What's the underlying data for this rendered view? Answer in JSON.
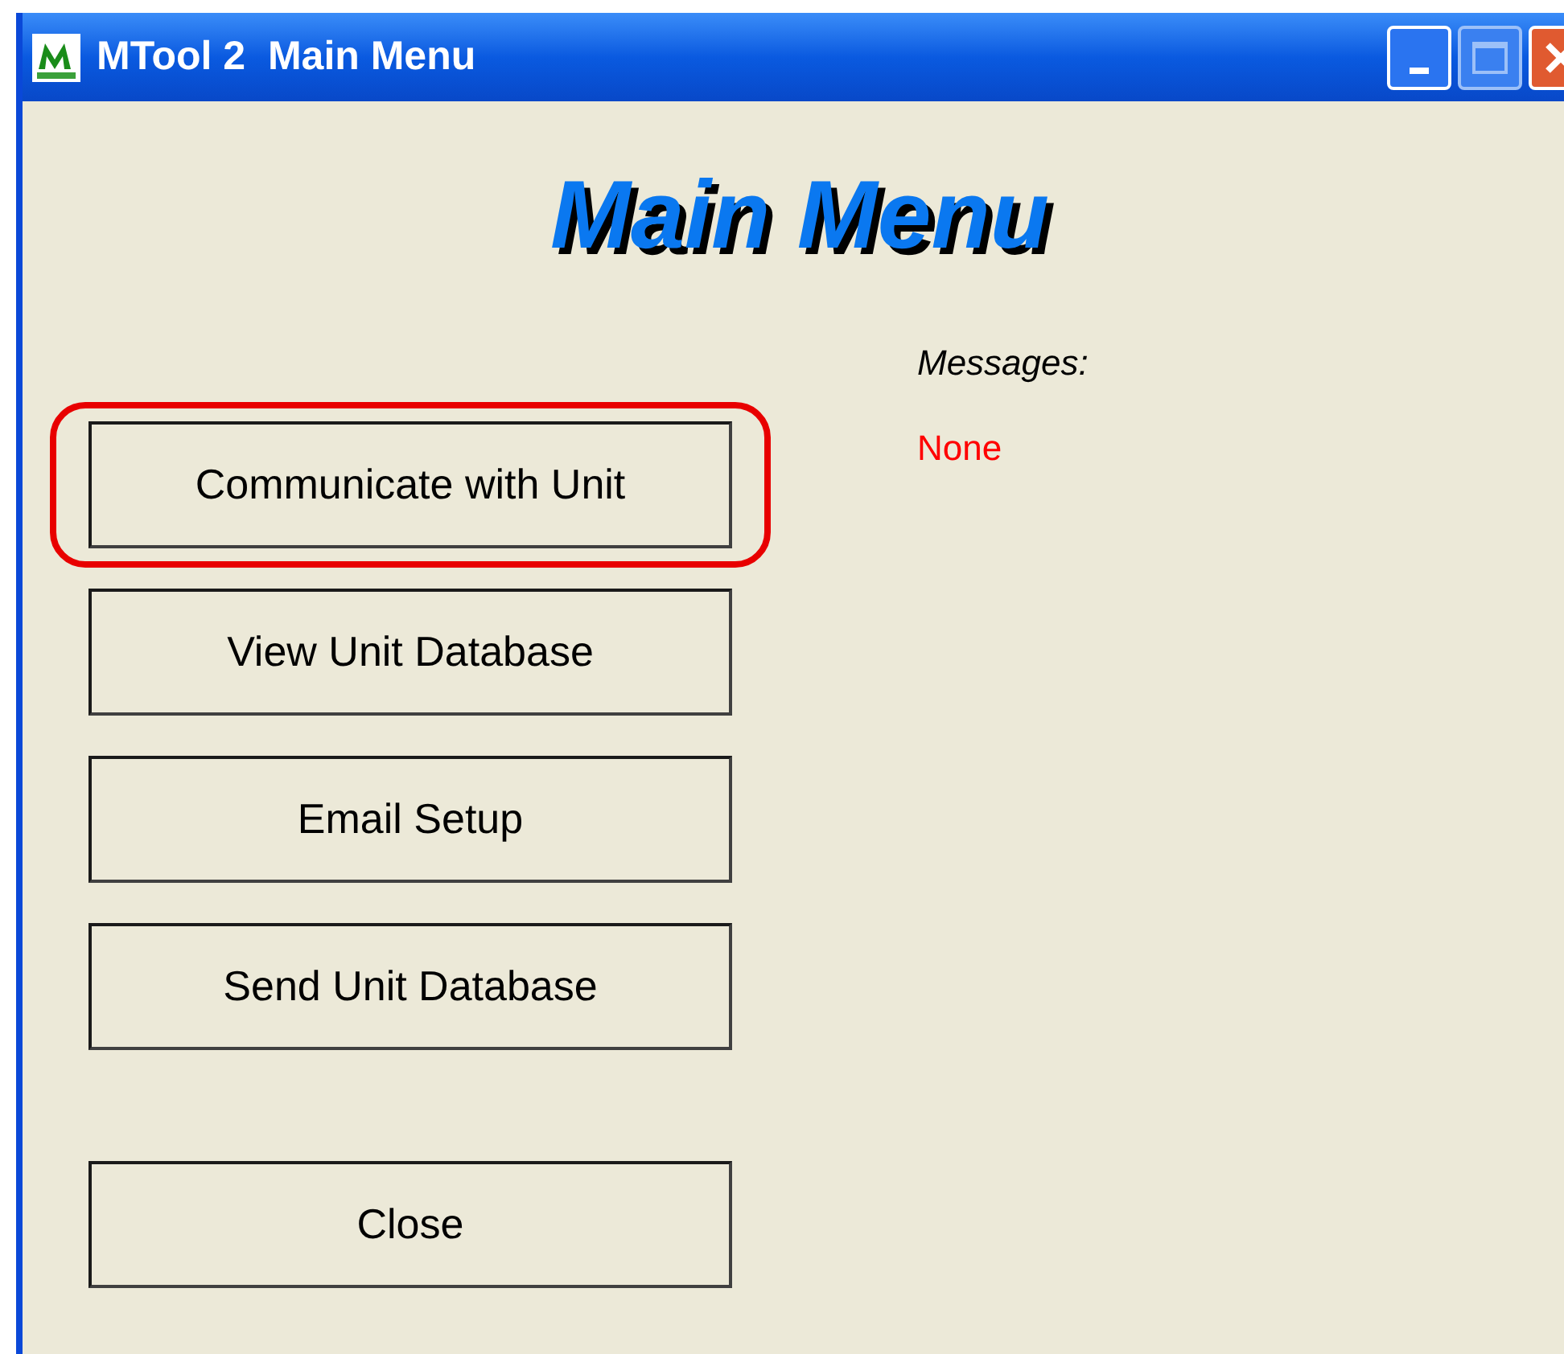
{
  "window": {
    "title": "MTool 2  Main Menu"
  },
  "heading": "Main Menu",
  "buttons": [
    {
      "label": "Communicate with Unit",
      "highlighted": true
    },
    {
      "label": "View Unit Database",
      "highlighted": false
    },
    {
      "label": "Email Setup",
      "highlighted": false
    },
    {
      "label": "Send Unit Database",
      "highlighted": false
    }
  ],
  "close_button": {
    "label": "Close"
  },
  "messages": {
    "label": "Messages:",
    "value": "None"
  }
}
